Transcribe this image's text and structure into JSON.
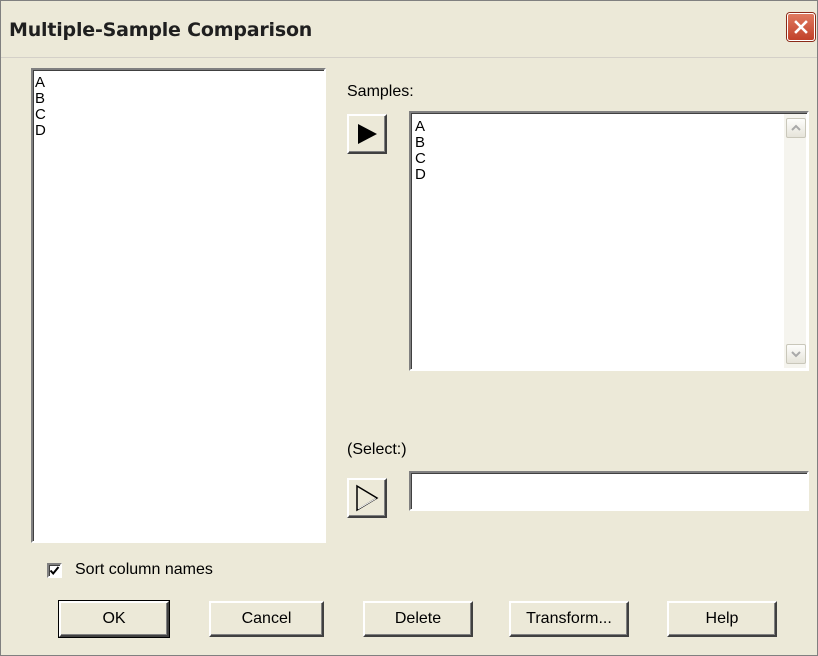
{
  "window": {
    "title": "Multiple-Sample Comparison",
    "close_icon": "close-icon"
  },
  "source_list": {
    "items": [
      "A",
      "B",
      "C",
      "D"
    ]
  },
  "samples": {
    "label": "Samples:",
    "items": [
      "A",
      "B",
      "C",
      "D"
    ],
    "add_icon": "right-arrow-filled-icon"
  },
  "select": {
    "label": "(Select:)",
    "value": "",
    "add_icon": "right-arrow-outline-icon"
  },
  "options": {
    "sort_column_names_label": "Sort column names",
    "sort_column_names_checked": true
  },
  "buttons": {
    "ok": "OK",
    "cancel": "Cancel",
    "delete": "Delete",
    "transform": "Transform...",
    "help": "Help"
  },
  "colors": {
    "dialog_bg": "#ece9d8",
    "close_button": "#c1412a"
  }
}
